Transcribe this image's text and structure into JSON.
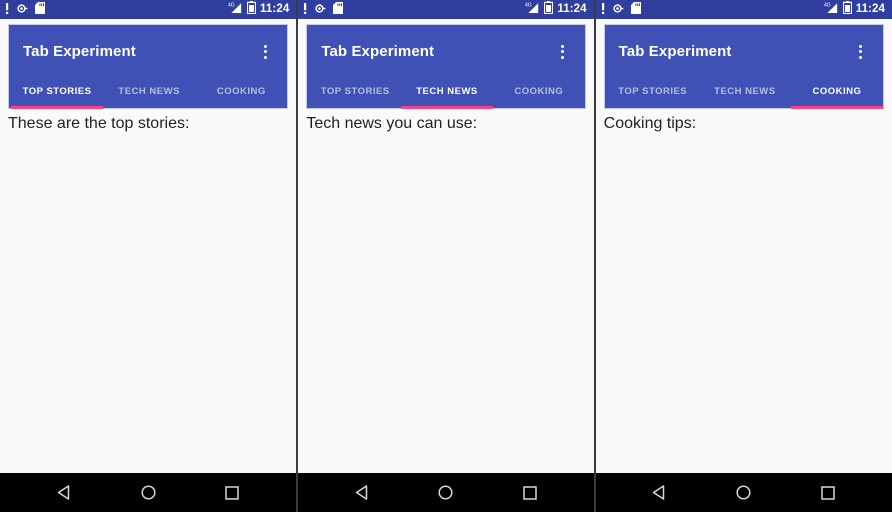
{
  "status_bar": {
    "icons": [
      "alert-exclamation-icon",
      "bug-icon",
      "sd-card-icon"
    ],
    "network_label": "4G",
    "signal_icon": "signal-bars-icon",
    "battery_icon": "battery-icon",
    "clock": "11:24",
    "background_color": "#303f9f"
  },
  "app_bar": {
    "title": "Tab Experiment",
    "overflow_label": "More options",
    "background_color": "#3f51b5",
    "indicator_color": "#ff4081"
  },
  "tabs": [
    {
      "id": "top-stories",
      "label": "TOP STORIES"
    },
    {
      "id": "tech-news",
      "label": "TECH NEWS"
    },
    {
      "id": "cooking",
      "label": "COOKING"
    }
  ],
  "nav_bar": {
    "back_label": "Back",
    "home_label": "Home",
    "recents_label": "Recents",
    "background_color": "#000000"
  },
  "screens": [
    {
      "active_tab_index": 0,
      "body_text": "These are the top stories:"
    },
    {
      "active_tab_index": 1,
      "body_text": "Tech news you can use:"
    },
    {
      "active_tab_index": 2,
      "body_text": "Cooking tips:"
    }
  ]
}
